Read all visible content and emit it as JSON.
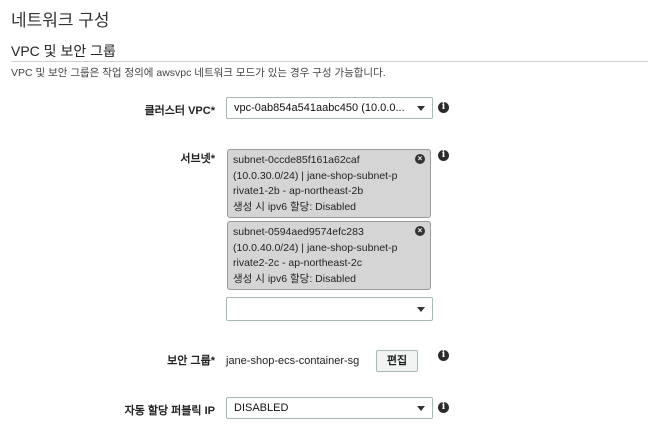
{
  "header": {
    "title": "네트워크 구성",
    "section_title": "VPC 및 보안 그룹",
    "description": "VPC 및 보안 그룹은 작업 정의에 awsvpc 네트워크 모드가 있는 경우 구성 가능합니다."
  },
  "cluster_vpc": {
    "label": "클러스터 VPC*",
    "value": "vpc-0ab854a541aabc450 (10.0.0...",
    "info": "i"
  },
  "subnets": {
    "label": "서브넷*",
    "info": "i",
    "chips": [
      {
        "line1": "subnet-0ccde85f161a62caf",
        "line2": "(10.0.30.0/24) | jane-shop-subnet-p",
        "line3": "rivate1-2b - ap-northeast-2b",
        "line4": "생성 시 ipv6 할당: Disabled",
        "remove": "×"
      },
      {
        "line1": "subnet-0594aed9574efc283",
        "line2": "(10.0.40.0/24) | jane-shop-subnet-p",
        "line3": "rivate2-2c - ap-northeast-2c",
        "line4": "생성 시 ipv6 할당: Disabled",
        "remove": "×"
      }
    ],
    "add_select_value": ""
  },
  "security_group": {
    "label": "보안 그룹*",
    "value": "jane-shop-ecs-container-sg",
    "edit_label": "편집",
    "info": "i"
  },
  "public_ip": {
    "label": "자동 할당 퍼블릭 IP",
    "value": "DISABLED",
    "info": "i"
  }
}
